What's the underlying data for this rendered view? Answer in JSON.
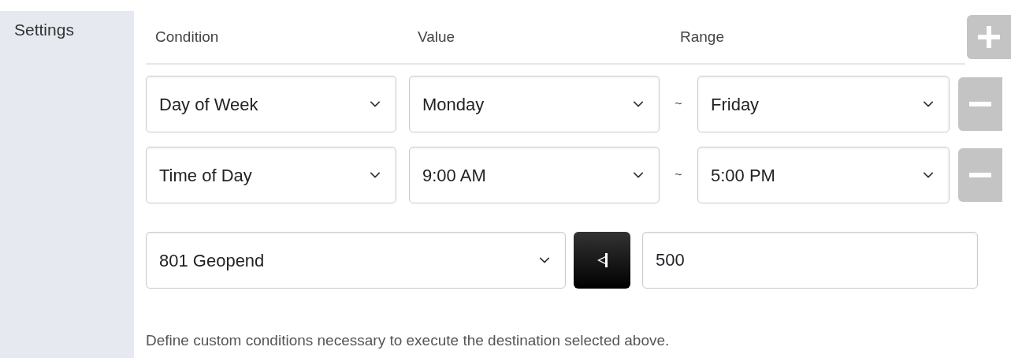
{
  "label": "Settings",
  "columns": [
    "Condition",
    "Value",
    "Range"
  ],
  "add_button": {
    "disabled": true
  },
  "conditions": [
    {
      "condition": "Day of Week",
      "value": "Monday",
      "separator": "~",
      "range_end": "Friday",
      "remove_disabled": true
    },
    {
      "condition": "Time of Day",
      "value": "9:00 AM",
      "separator": "~",
      "range_end": "5:00 PM",
      "remove_disabled": true
    }
  ],
  "destination": {
    "select": "801 Geopend",
    "value": "500"
  },
  "help_text": "Define custom conditions necessary to execute the destination selected above."
}
